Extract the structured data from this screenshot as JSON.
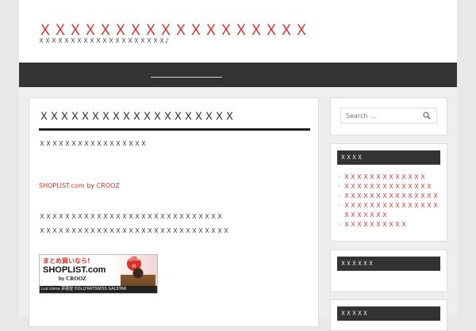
{
  "header": {
    "site_title": "ＸＸＸＸＸＸＸＸＸＸＸＸＸＸＸＸＸＸ",
    "site_desc": "ＸＸＸＸＸＸＸＸＸＸＸＸＸＸＸＸＸＸＸＸ♪"
  },
  "post": {
    "title": "ＸＸＸＸＸＸＸＸＸＸＸＸＸＸＸＸＸＸＸ",
    "p1": "ＸＸＸＸＸＸＸＸＸＸＸＸＸＸＸＸＸ",
    "shop_link": "SHOPLIST.com by CROOZ",
    "p2": "ＸＸＸＸＸＸＸＸＸＸＸＸＸＸＸＸＸＸＸＸＸＸＸＸＸＸＸＸＸ",
    "p3": "ＸＸＸＸＸＸＸＸＸＸＸＸＸＸＸＸＸＸＸＸＸＸＸＸＸＸＸＸＸＸ",
    "banner": {
      "top_text": "まとめ買いなら!",
      "tag_text": "送料無料",
      "brand": "SHOPLIST.com",
      "by": "by CROOZ",
      "strip": "Luz Llena  夢展望  DOLLYRATSWISS  GALSTAR"
    }
  },
  "sidebar": {
    "search_placeholder": "Search ...",
    "recent_title": "ＸＸＸＸ",
    "recent_items": [
      "ＸＸＸＸＸＸＸＸＸＸＸＸＸ",
      "ＸＸＸＸＸＸＸＸＸＸＸＸＸＸ",
      "ＸＸＸＸＸＸＸＸＸＸＸＸＸＸＸ",
      "ＸＸＸＸＸＸＸＸＸＸＸＸＸＸＸＸＸＸＸＸＸＸ",
      "ＸＸＸＸＸＸＸＸＸＸ"
    ],
    "archive_title": "ＸＸＸＸＸＸ",
    "cat_title": "ＸＸＸＸＸ"
  },
  "colors": {
    "accent": "#d9302a",
    "nav_bg": "#333333",
    "page_bg": "#e8e8e8"
  }
}
